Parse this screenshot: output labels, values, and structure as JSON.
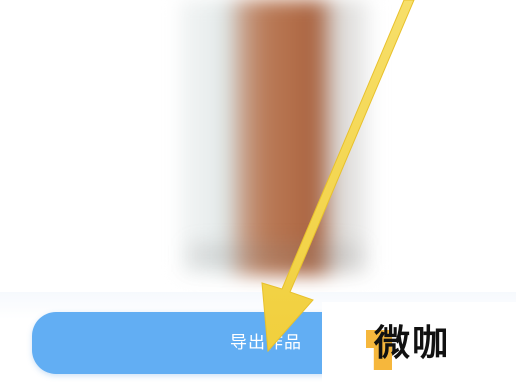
{
  "export_button": {
    "label": "导出作品"
  },
  "watermark": {
    "text": "微咖"
  },
  "colors": {
    "button": "#62aef3",
    "arrow": "#f4d64e",
    "watermark_accent": "#f6b73c"
  },
  "icons": {
    "annotation": "yellow-arrow-icon",
    "watermark": "weika-logo-icon"
  }
}
